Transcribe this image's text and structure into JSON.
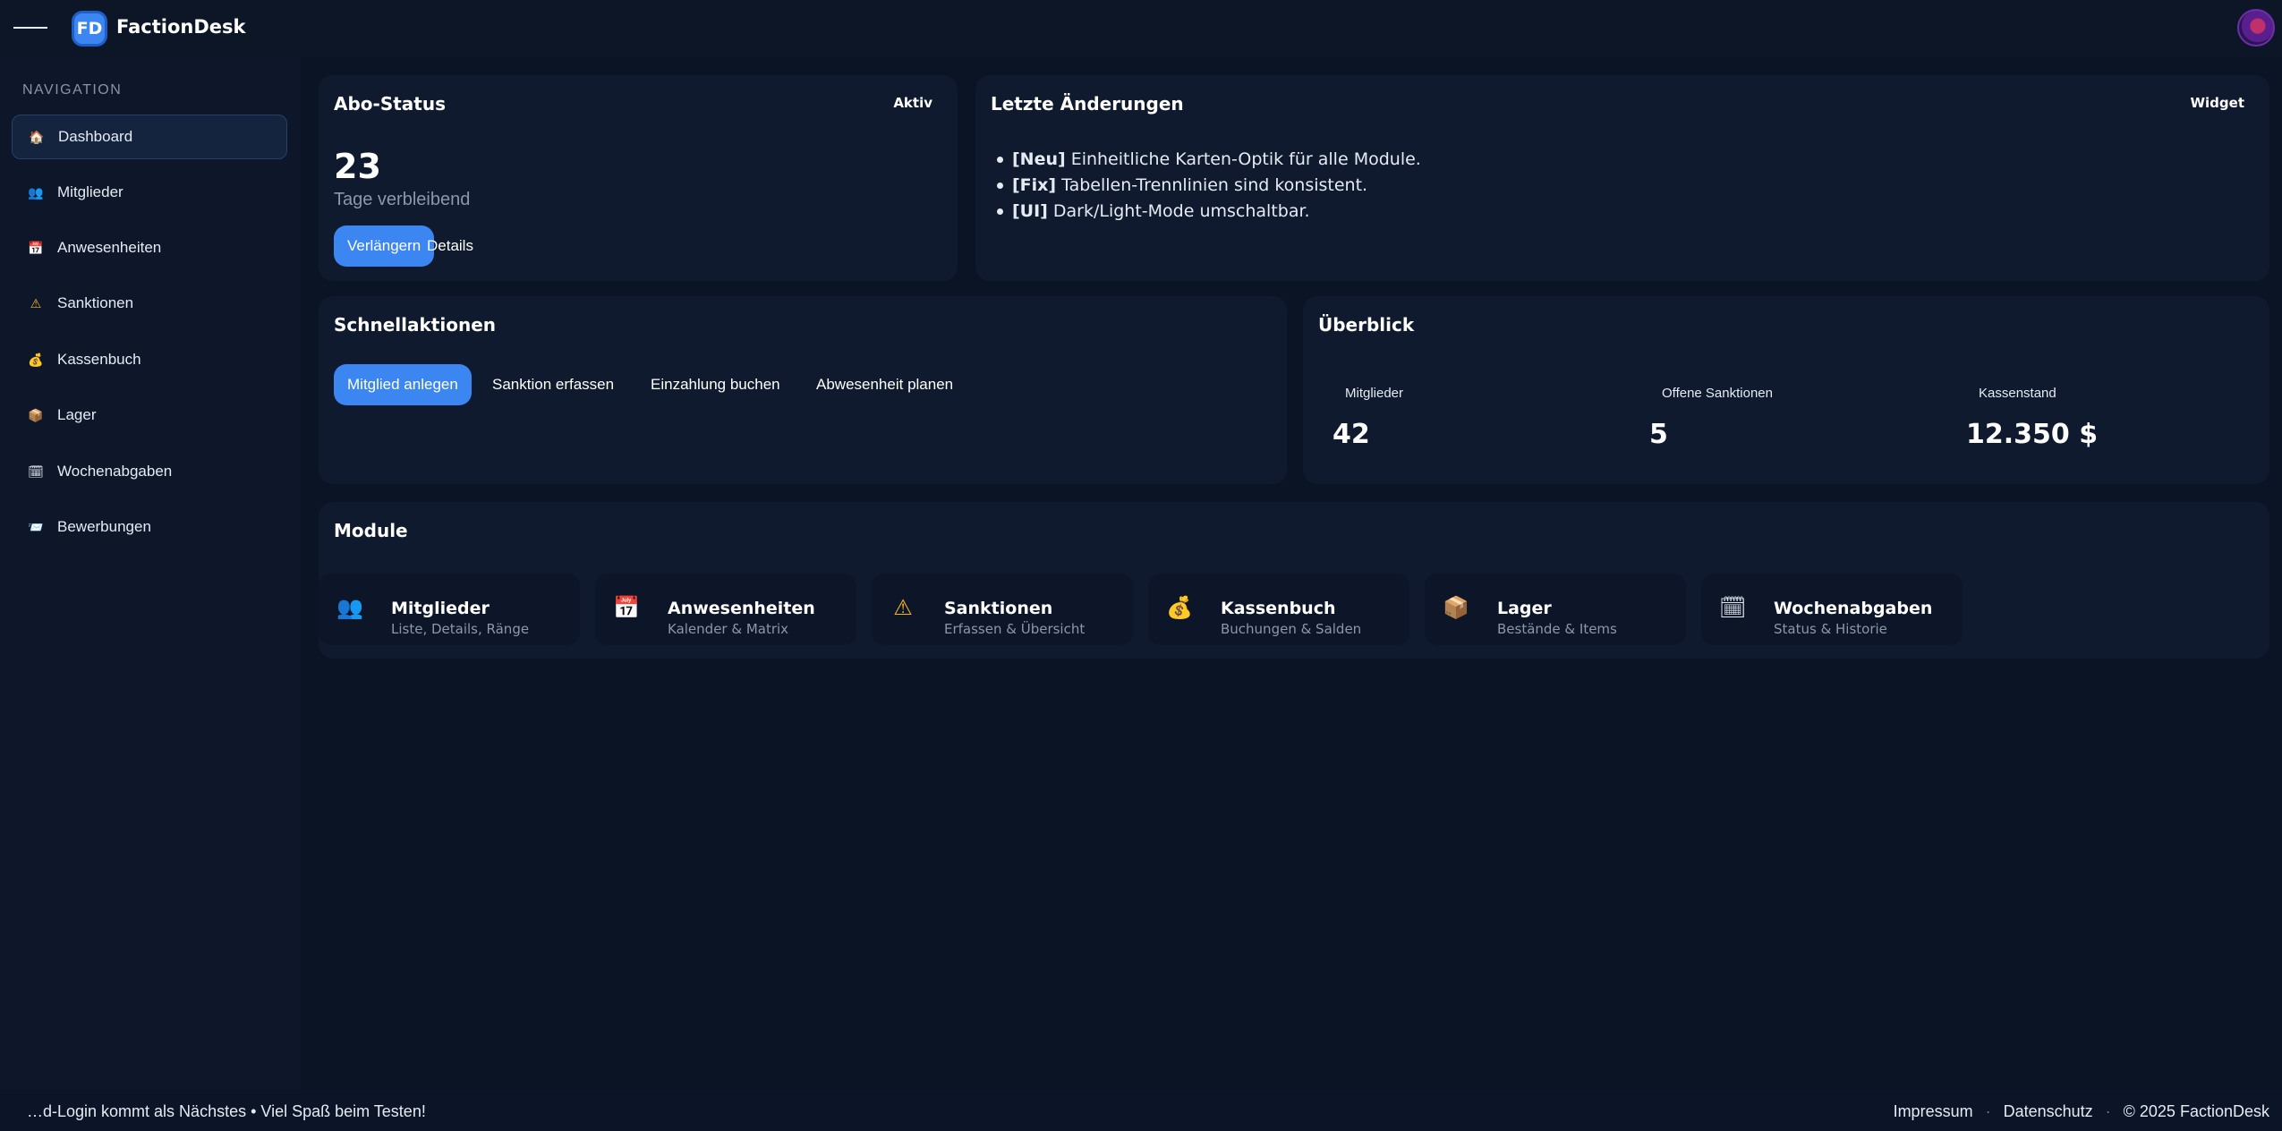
{
  "header": {
    "logo_initials": "FD",
    "brand": "FactionDesk"
  },
  "sidebar": {
    "title": "NAVIGATION",
    "items": [
      {
        "label": "Dashboard",
        "icon": "🏠"
      },
      {
        "label": "Mitglieder",
        "icon": "👥"
      },
      {
        "label": "Anwesenheiten",
        "icon": "📅"
      },
      {
        "label": "Sanktionen",
        "icon": "⚠"
      },
      {
        "label": "Kassenbuch",
        "icon": "💰"
      },
      {
        "label": "Lager",
        "icon": "📦"
      },
      {
        "label": "Wochenabgaben",
        "icon": "🗓"
      },
      {
        "label": "Bewerbungen",
        "icon": "📨"
      }
    ]
  },
  "abo": {
    "title": "Abo-Status",
    "badge": "Aktiv",
    "days": "23",
    "days_label": "Tage verbleibend",
    "renew_button": "Verlängern",
    "details_button": "Details"
  },
  "changes": {
    "title": "Letzte Änderungen",
    "badge": "Widget",
    "items": [
      {
        "tag": "[Neu]",
        "text": "Einheitliche Karten-Optik für alle Module."
      },
      {
        "tag": "[Fix]",
        "text": "Tabellen-Trennlinien sind konsistent."
      },
      {
        "tag": "[UI]",
        "text": "Dark/Light-Mode umschaltbar."
      }
    ]
  },
  "quick": {
    "title": "Schnellaktionen",
    "actions": [
      "Mitglied anlegen",
      "Sanktion erfassen",
      "Einzahlung buchen",
      "Abwesenheit planen"
    ]
  },
  "overview": {
    "title": "Überblick",
    "stats": [
      {
        "label": "Mitglieder",
        "value": "42"
      },
      {
        "label": "Offene Sanktionen",
        "value": "5"
      },
      {
        "label": "Kassenstand",
        "value": "12.350 $"
      }
    ]
  },
  "modules": {
    "title": "Module",
    "items": [
      {
        "name": "Mitglieder",
        "desc": "Liste, Details, Ränge",
        "icon": "👥"
      },
      {
        "name": "Anwesenheiten",
        "desc": "Kalender & Matrix",
        "icon": "📅"
      },
      {
        "name": "Sanktionen",
        "desc": "Erfassen & Übersicht",
        "icon": "⚠"
      },
      {
        "name": "Kassenbuch",
        "desc": "Buchungen & Salden",
        "icon": "💰"
      },
      {
        "name": "Lager",
        "desc": "Bestände & Items",
        "icon": "📦"
      },
      {
        "name": "Wochenabgaben",
        "desc": "Status & Historie",
        "icon": "🗓"
      }
    ]
  },
  "footer": {
    "message": "…d-Login kommt als Nächstes • Viel Spaß beim Testen!",
    "links": [
      "Impressum",
      "Datenschutz",
      "© 2025 FactionDesk"
    ],
    "separator": "·"
  }
}
